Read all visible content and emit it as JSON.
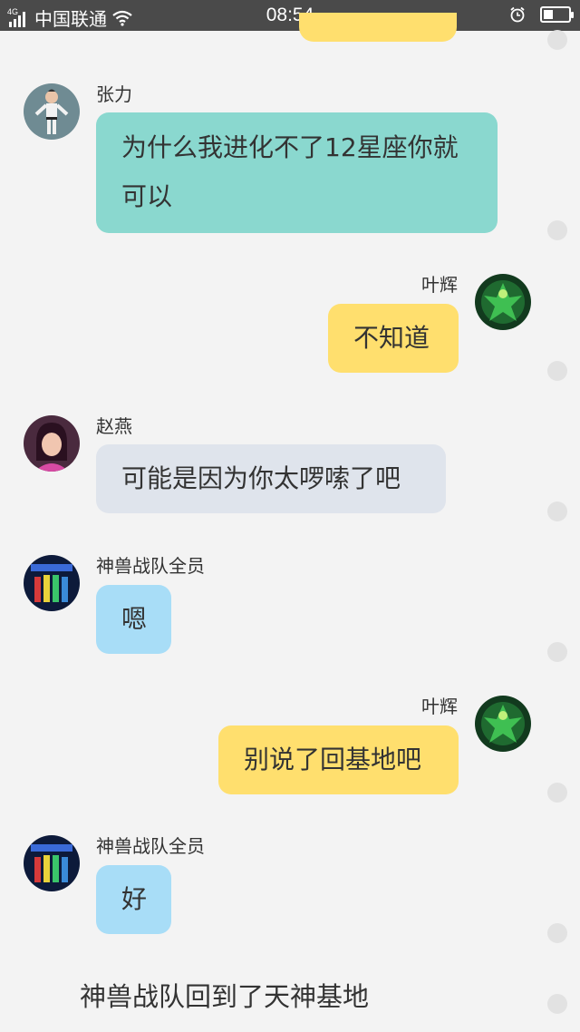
{
  "status_bar": {
    "network_type": "4G",
    "carrier": "中国联通",
    "time": "08:54",
    "battery_level": 0.4
  },
  "messages": [
    {
      "sender": "张力",
      "text": "为什么我进化不了12星座你就可以",
      "side": "left",
      "bubble_color": "#8ad8cf",
      "avatar_icon": "avatar-zhangli-icon"
    },
    {
      "sender": "叶辉",
      "text": "不知道",
      "side": "right",
      "bubble_color": "#ffdf6e",
      "avatar_icon": "avatar-yehui-icon"
    },
    {
      "sender": "赵燕",
      "text": "可能是因为你太啰嗦了吧",
      "side": "left",
      "bubble_color": "#dfe4ec",
      "avatar_icon": "avatar-zhaoyan-icon"
    },
    {
      "sender": "神兽战队全员",
      "text": "嗯",
      "side": "left",
      "bubble_color": "#a8ddf7",
      "avatar_icon": "avatar-team-icon"
    },
    {
      "sender": "叶辉",
      "text": "别说了回基地吧",
      "side": "right",
      "bubble_color": "#ffdf6e",
      "avatar_icon": "avatar-yehui-icon"
    },
    {
      "sender": "神兽战队全员",
      "text": "好",
      "side": "left",
      "bubble_color": "#a8ddf7",
      "avatar_icon": "avatar-team-icon"
    }
  ],
  "narration": "神兽战队回到了天神基地",
  "colors": {
    "status_bar_bg": "#4a4a4a",
    "background": "#f3f3f3",
    "select_dot": "#e2e2e2"
  }
}
